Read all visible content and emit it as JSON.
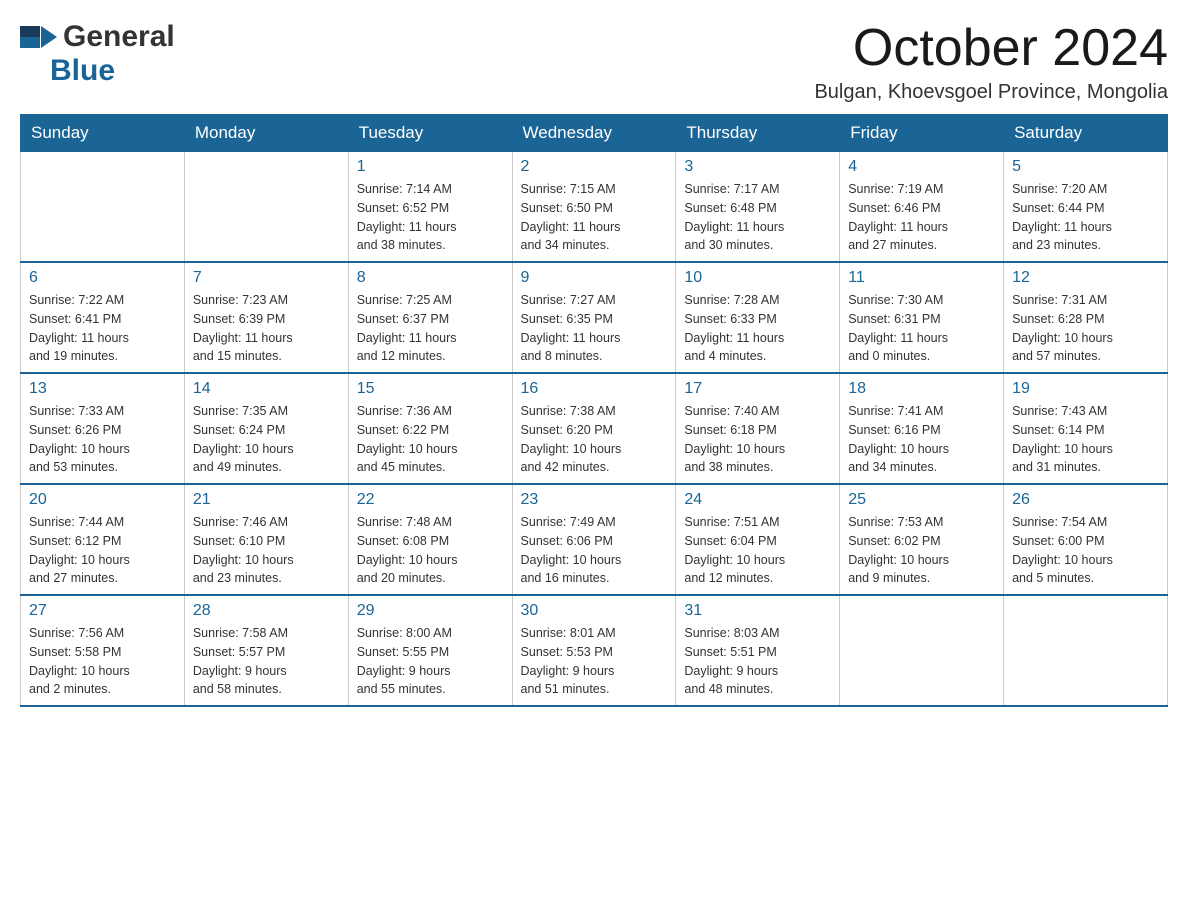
{
  "logo": {
    "general": "General",
    "blue": "Blue"
  },
  "header": {
    "title": "October 2024",
    "location": "Bulgan, Khoevsgoel Province, Mongolia"
  },
  "days_of_week": [
    "Sunday",
    "Monday",
    "Tuesday",
    "Wednesday",
    "Thursday",
    "Friday",
    "Saturday"
  ],
  "weeks": [
    [
      {
        "day": "",
        "info": ""
      },
      {
        "day": "",
        "info": ""
      },
      {
        "day": "1",
        "info": "Sunrise: 7:14 AM\nSunset: 6:52 PM\nDaylight: 11 hours\nand 38 minutes."
      },
      {
        "day": "2",
        "info": "Sunrise: 7:15 AM\nSunset: 6:50 PM\nDaylight: 11 hours\nand 34 minutes."
      },
      {
        "day": "3",
        "info": "Sunrise: 7:17 AM\nSunset: 6:48 PM\nDaylight: 11 hours\nand 30 minutes."
      },
      {
        "day": "4",
        "info": "Sunrise: 7:19 AM\nSunset: 6:46 PM\nDaylight: 11 hours\nand 27 minutes."
      },
      {
        "day": "5",
        "info": "Sunrise: 7:20 AM\nSunset: 6:44 PM\nDaylight: 11 hours\nand 23 minutes."
      }
    ],
    [
      {
        "day": "6",
        "info": "Sunrise: 7:22 AM\nSunset: 6:41 PM\nDaylight: 11 hours\nand 19 minutes."
      },
      {
        "day": "7",
        "info": "Sunrise: 7:23 AM\nSunset: 6:39 PM\nDaylight: 11 hours\nand 15 minutes."
      },
      {
        "day": "8",
        "info": "Sunrise: 7:25 AM\nSunset: 6:37 PM\nDaylight: 11 hours\nand 12 minutes."
      },
      {
        "day": "9",
        "info": "Sunrise: 7:27 AM\nSunset: 6:35 PM\nDaylight: 11 hours\nand 8 minutes."
      },
      {
        "day": "10",
        "info": "Sunrise: 7:28 AM\nSunset: 6:33 PM\nDaylight: 11 hours\nand 4 minutes."
      },
      {
        "day": "11",
        "info": "Sunrise: 7:30 AM\nSunset: 6:31 PM\nDaylight: 11 hours\nand 0 minutes."
      },
      {
        "day": "12",
        "info": "Sunrise: 7:31 AM\nSunset: 6:28 PM\nDaylight: 10 hours\nand 57 minutes."
      }
    ],
    [
      {
        "day": "13",
        "info": "Sunrise: 7:33 AM\nSunset: 6:26 PM\nDaylight: 10 hours\nand 53 minutes."
      },
      {
        "day": "14",
        "info": "Sunrise: 7:35 AM\nSunset: 6:24 PM\nDaylight: 10 hours\nand 49 minutes."
      },
      {
        "day": "15",
        "info": "Sunrise: 7:36 AM\nSunset: 6:22 PM\nDaylight: 10 hours\nand 45 minutes."
      },
      {
        "day": "16",
        "info": "Sunrise: 7:38 AM\nSunset: 6:20 PM\nDaylight: 10 hours\nand 42 minutes."
      },
      {
        "day": "17",
        "info": "Sunrise: 7:40 AM\nSunset: 6:18 PM\nDaylight: 10 hours\nand 38 minutes."
      },
      {
        "day": "18",
        "info": "Sunrise: 7:41 AM\nSunset: 6:16 PM\nDaylight: 10 hours\nand 34 minutes."
      },
      {
        "day": "19",
        "info": "Sunrise: 7:43 AM\nSunset: 6:14 PM\nDaylight: 10 hours\nand 31 minutes."
      }
    ],
    [
      {
        "day": "20",
        "info": "Sunrise: 7:44 AM\nSunset: 6:12 PM\nDaylight: 10 hours\nand 27 minutes."
      },
      {
        "day": "21",
        "info": "Sunrise: 7:46 AM\nSunset: 6:10 PM\nDaylight: 10 hours\nand 23 minutes."
      },
      {
        "day": "22",
        "info": "Sunrise: 7:48 AM\nSunset: 6:08 PM\nDaylight: 10 hours\nand 20 minutes."
      },
      {
        "day": "23",
        "info": "Sunrise: 7:49 AM\nSunset: 6:06 PM\nDaylight: 10 hours\nand 16 minutes."
      },
      {
        "day": "24",
        "info": "Sunrise: 7:51 AM\nSunset: 6:04 PM\nDaylight: 10 hours\nand 12 minutes."
      },
      {
        "day": "25",
        "info": "Sunrise: 7:53 AM\nSunset: 6:02 PM\nDaylight: 10 hours\nand 9 minutes."
      },
      {
        "day": "26",
        "info": "Sunrise: 7:54 AM\nSunset: 6:00 PM\nDaylight: 10 hours\nand 5 minutes."
      }
    ],
    [
      {
        "day": "27",
        "info": "Sunrise: 7:56 AM\nSunset: 5:58 PM\nDaylight: 10 hours\nand 2 minutes."
      },
      {
        "day": "28",
        "info": "Sunrise: 7:58 AM\nSunset: 5:57 PM\nDaylight: 9 hours\nand 58 minutes."
      },
      {
        "day": "29",
        "info": "Sunrise: 8:00 AM\nSunset: 5:55 PM\nDaylight: 9 hours\nand 55 minutes."
      },
      {
        "day": "30",
        "info": "Sunrise: 8:01 AM\nSunset: 5:53 PM\nDaylight: 9 hours\nand 51 minutes."
      },
      {
        "day": "31",
        "info": "Sunrise: 8:03 AM\nSunset: 5:51 PM\nDaylight: 9 hours\nand 48 minutes."
      },
      {
        "day": "",
        "info": ""
      },
      {
        "day": "",
        "info": ""
      }
    ]
  ]
}
